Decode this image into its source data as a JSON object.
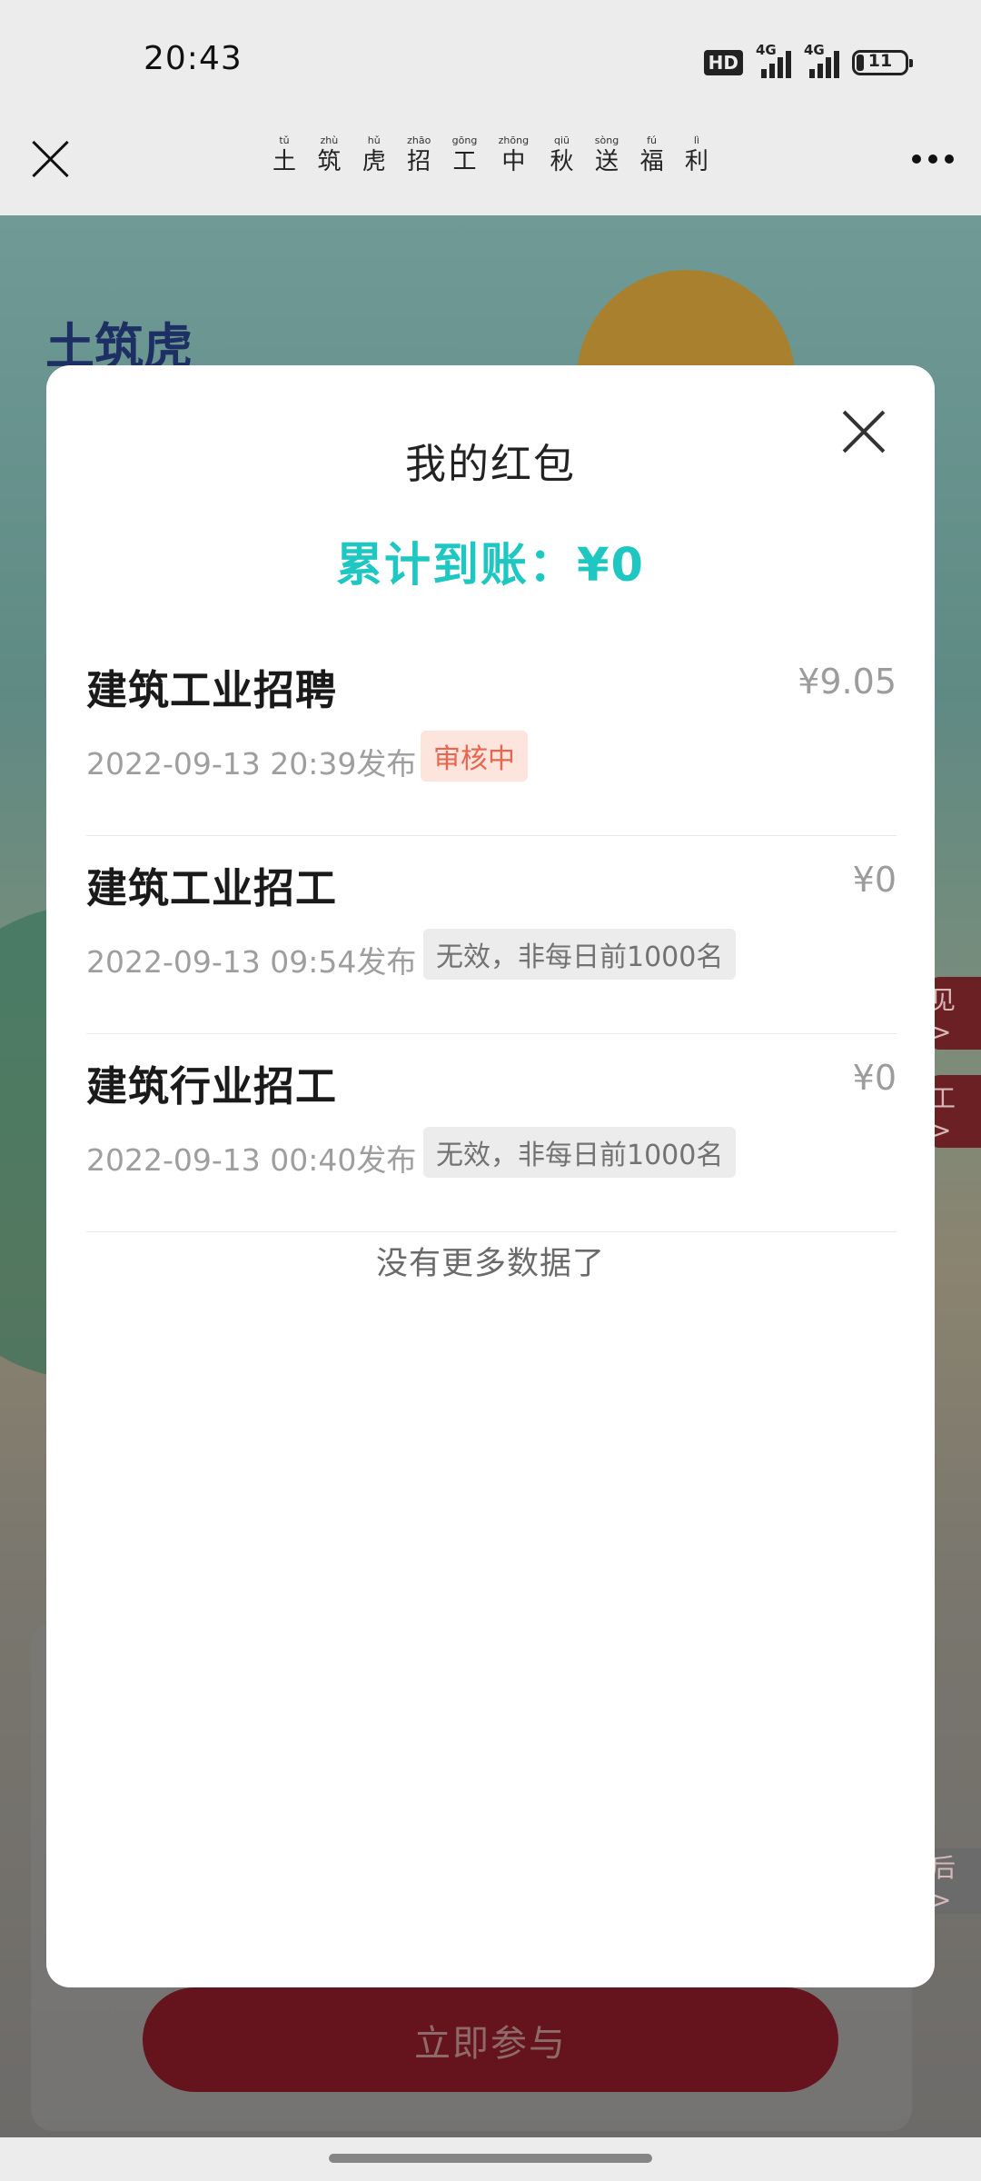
{
  "status_bar": {
    "time": "20:43",
    "hd_label": "HD",
    "network1": "4G",
    "network2": "4G",
    "battery": "11"
  },
  "title_bar": {
    "title_chars": [
      {
        "hz": "土",
        "py": "tǔ"
      },
      {
        "hz": "筑",
        "py": "zhù"
      },
      {
        "hz": "虎",
        "py": "hǔ"
      },
      {
        "hz": "招",
        "py": "zhāo"
      },
      {
        "hz": "工",
        "py": "gōng"
      },
      {
        "hz": "中",
        "py": "zhōng"
      },
      {
        "hz": "秋",
        "py": "qiū"
      },
      {
        "hz": "送",
        "py": "sòng"
      },
      {
        "hz": "福",
        "py": "fú"
      },
      {
        "hz": "利",
        "py": "lì"
      }
    ]
  },
  "background": {
    "brand": "土筑虎",
    "tag1": "见 >",
    "tag2": "工 >",
    "tag3": "后 >",
    "join_button": "立即参与"
  },
  "modal": {
    "title": "我的红包",
    "total_label": "累计到账：",
    "total_value": "¥0",
    "items": [
      {
        "title": "建筑工业招聘",
        "amount": "¥9.05",
        "date": "2022-09-13 20:39发布",
        "badge": "审核中",
        "badge_type": "review"
      },
      {
        "title": "建筑工业招工",
        "amount": "¥0",
        "date": "2022-09-13 09:54发布",
        "badge": "无效，非每日前1000名",
        "badge_type": "invalid"
      },
      {
        "title": "建筑行业招工",
        "amount": "¥0",
        "date": "2022-09-13 00:40发布",
        "badge": "无效，非每日前1000名",
        "badge_type": "invalid"
      }
    ],
    "no_more": "没有更多数据了"
  },
  "colors": {
    "accent_teal": "#1ec7c1",
    "review_badge_bg": "#fde4dc",
    "review_badge_text": "#e8664e",
    "invalid_badge_bg": "#ececec"
  }
}
